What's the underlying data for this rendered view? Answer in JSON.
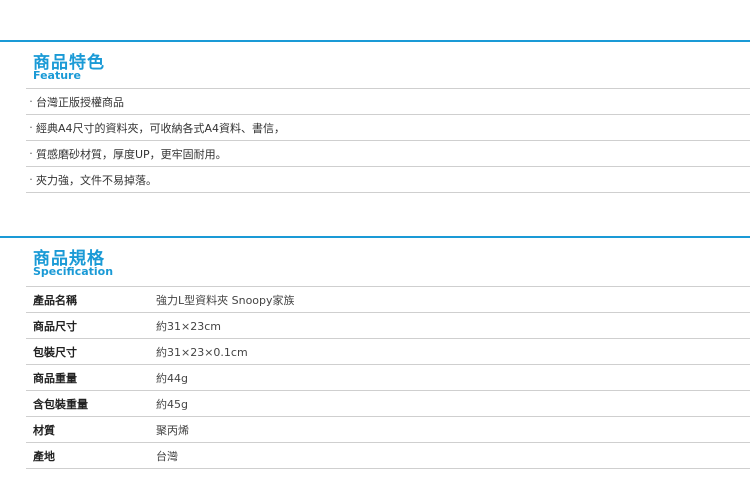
{
  "feature": {
    "title": "商品特色",
    "subtitle": "Feature",
    "items": [
      "台灣正版授權商品",
      "經典A4尺寸的資料夾，可收納各式A4資料、書信，",
      "質感磨砂材質，厚度UP，更牢固耐用。",
      "夾力強，文件不易掉落。"
    ]
  },
  "specification": {
    "title": "商品規格",
    "subtitle": "Specification",
    "rows": [
      {
        "label": "產品名稱",
        "value": "強力L型資料夾 Snoopy家族"
      },
      {
        "label": "商品尺寸",
        "value": "約31×23cm"
      },
      {
        "label": "包裝尺寸",
        "value": "約31×23×0.1cm"
      },
      {
        "label": "商品重量",
        "value": "約44g"
      },
      {
        "label": "含包裝重量",
        "value": "約45g"
      },
      {
        "label": "材質",
        "value": "聚丙烯"
      },
      {
        "label": "產地",
        "value": "台灣"
      }
    ]
  }
}
